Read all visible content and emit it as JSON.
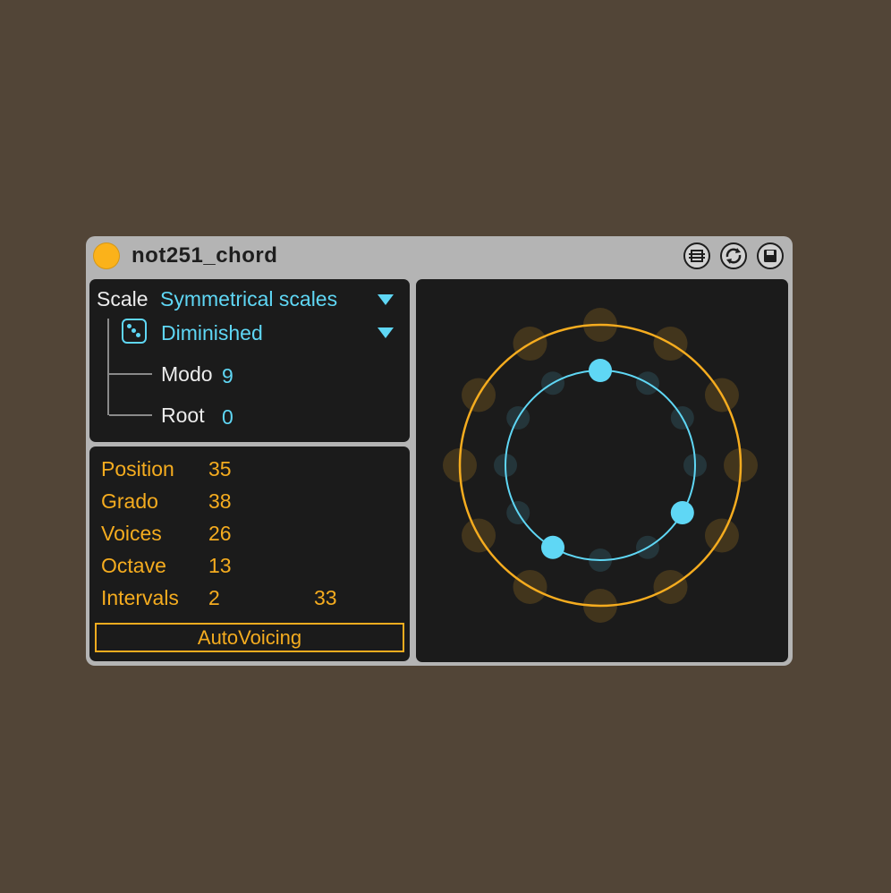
{
  "device": {
    "title": "not251_chord",
    "colors": {
      "background": "#524537",
      "frame": "#b4b4b4",
      "panel": "#1b1b1b",
      "accent_cyan": "#5fd7f5",
      "accent_orange": "#f5ac1f",
      "power": "#fbb21a"
    },
    "titlebar_icons": [
      "fold-icon",
      "hot-swap-icon",
      "save-preset-icon"
    ]
  },
  "scale": {
    "label": "Scale",
    "family_value": "Symmetrical scales",
    "type_value": "Diminished",
    "dice_icon": "dice-icon",
    "modo_label": "Modo",
    "modo_value": "9",
    "root_label": "Root",
    "root_value": "0"
  },
  "params": {
    "position_label": "Position",
    "position_value": "35",
    "grado_label": "Grado",
    "grado_value": "38",
    "voices_label": "Voices",
    "voices_value": "26",
    "octave_label": "Octave",
    "octave_value": "13",
    "intervals_label": "Intervals",
    "intervals_value_1": "2",
    "intervals_value_2": "33",
    "autovoicing_label": "AutoVoicing"
  },
  "circle": {
    "outer_slots": 12,
    "inner_slots": 12,
    "active_inner_slots": [
      0,
      4,
      7
    ]
  }
}
